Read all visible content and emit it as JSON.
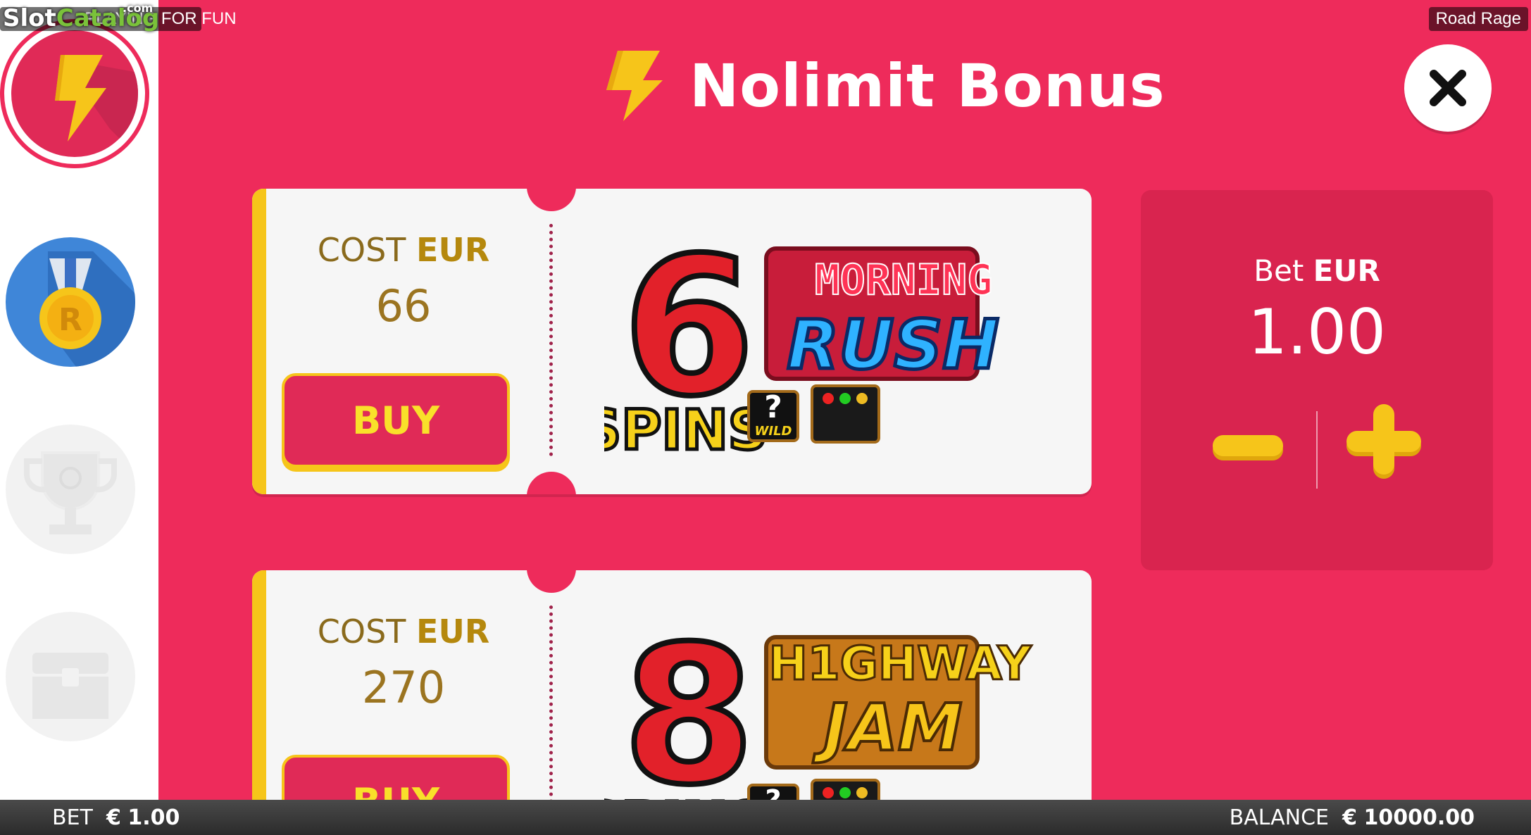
{
  "watermark": {
    "slot": "Slot",
    "catalog": "Catalog",
    "com": ".com"
  },
  "topbar": {
    "mode": "PLAYING FOR FUN",
    "game_name": "Road Rage"
  },
  "header": {
    "title": "Nolimit Bonus"
  },
  "cards": [
    {
      "cost_prefix": "COST",
      "cost_currency": "EUR",
      "cost_value": "66",
      "buy_label": "BUY",
      "art": {
        "number": "6",
        "line1": "MORNING",
        "line2": "RUSH",
        "spins": "SPINS",
        "wild": "WILD"
      }
    },
    {
      "cost_prefix": "COST",
      "cost_currency": "EUR",
      "cost_value": "270",
      "buy_label": "BUY",
      "art": {
        "number": "8",
        "line1": "H1GHWAY",
        "line2": "JAM",
        "spins": "SPINS",
        "wild": "WILD"
      }
    }
  ],
  "bet_panel": {
    "label": "Bet",
    "currency": "EUR",
    "value": "1.00"
  },
  "bottom_bar": {
    "bet_label": "BET",
    "bet_symbol": "€",
    "bet_value": "1.00",
    "balance_label": "BALANCE",
    "balance_symbol": "€",
    "balance_value": "10000.00"
  },
  "sidebar": {
    "items": [
      "bonus-icon",
      "medal-icon",
      "trophy-icon",
      "chest-icon"
    ]
  },
  "colors": {
    "background": "#ee2b5b",
    "accent": "#f6c51a",
    "buy_text": "#f9e02a"
  }
}
